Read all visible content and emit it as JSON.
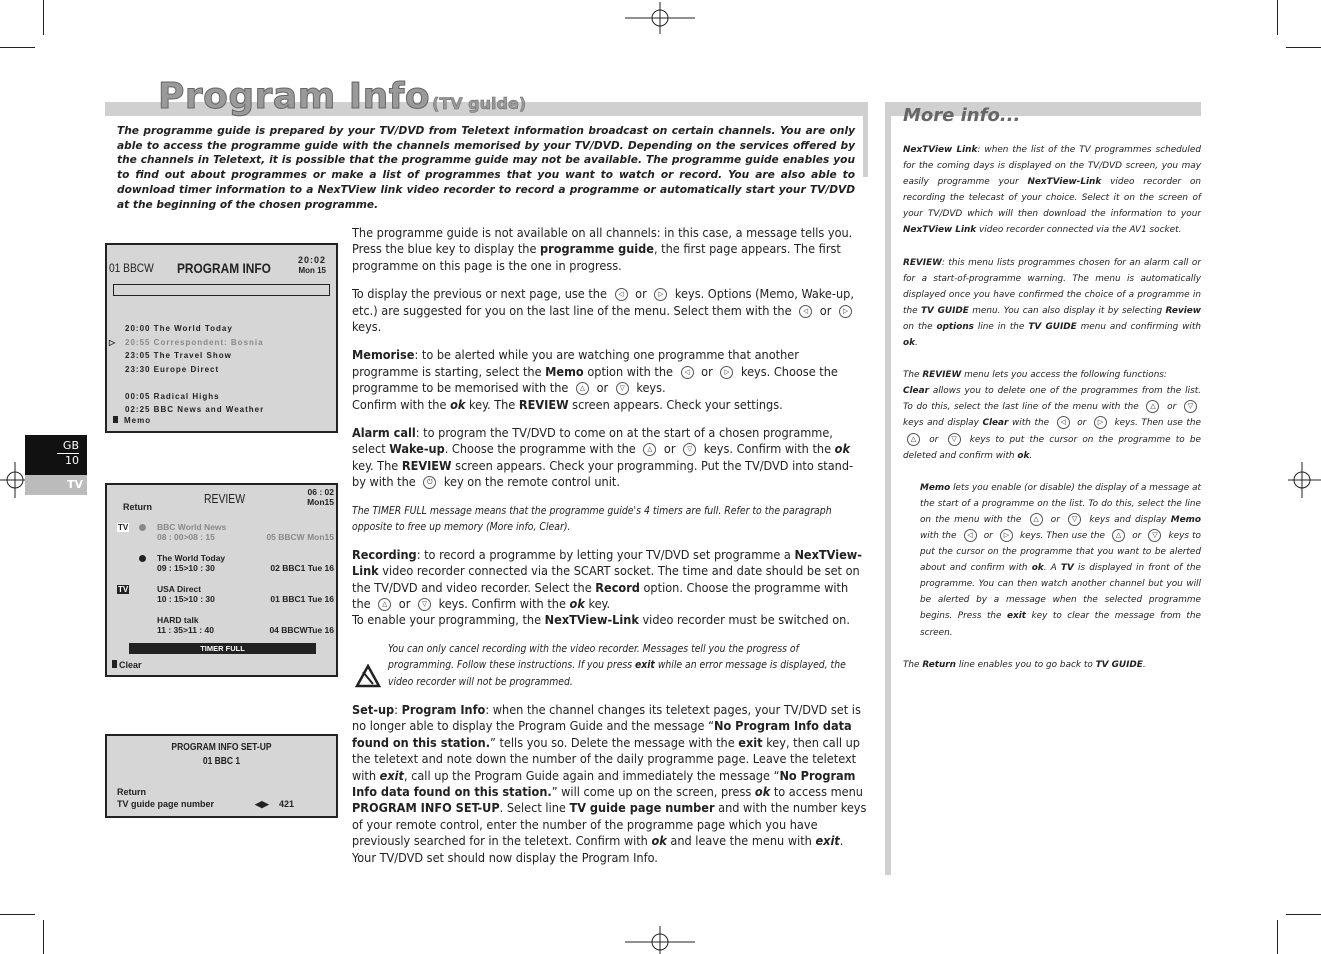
{
  "page": {
    "title": "Program Info",
    "subtitle": "(TV guide)",
    "intro": "The programme guide is prepared by your TV/DVD from Teletext information broadcast on certain channels. You are only able to access the programme guide with the channels memorised by your TV/DVD. Depending on the services offered by the channels in Teletext, it is possible that the programme guide may not be available. The programme guide enables you to find out about programmes or make a list of programmes that you want to watch or record. You are also able to download timer information to a NexTView link video recorder to record a programme or automatically start your TV/DVD at the beginning of the chosen programme."
  },
  "tab": {
    "lang": "GB",
    "page": "10",
    "section": "TV"
  },
  "screen1": {
    "channel": "01 BBCW",
    "title": "PROGRAM INFO",
    "time": "20:02",
    "date": "Mon 15",
    "items": [
      "20:00 The World Today",
      "20:55 Correspondent: Bosnia",
      "23:05 The Travel Show",
      "23:30 Europe Direct",
      "",
      "00:05 Radical Highs",
      "02:25 BBC News and Weather"
    ],
    "memo": "Memo"
  },
  "screen2": {
    "title": "REVIEW",
    "time": "06 : 02",
    "date": "Mon15",
    "return": "Return",
    "items": [
      {
        "icon": "TV",
        "clock": true,
        "name": "BBC World News",
        "time": "08 : 00>08 : 15",
        "ch": "05 BBCW Mon15",
        "dim": true
      },
      {
        "icon": "",
        "clock": true,
        "name": "The World Today",
        "time": "09 : 15>10 : 30",
        "ch": "02 BBC1  Tue 16"
      },
      {
        "icon": "TV",
        "clock": false,
        "name": "USA Direct",
        "time": "10 : 15>10 : 30",
        "ch": "01 BBC1  Tue 16"
      },
      {
        "icon": "",
        "clock": false,
        "name": "HARD talk",
        "time": "11 : 35>11 : 40",
        "ch": "04 BBCWTue 16"
      }
    ],
    "banner": "TIMER FULL",
    "clear": "Clear"
  },
  "screen3": {
    "title": "PROGRAM INFO SET-UP",
    "channel": "01 BBC 1",
    "return": "Return",
    "line": "TV guide page number",
    "value": "421"
  },
  "main": [
    [
      [
        "The programme guide is not available on all channels: in this case, a message tells you. Press the blue key to display the ",
        ""
      ],
      [
        "programme guide",
        "b"
      ],
      [
        ", the first page appears. The first programme on this page is the one in progress.",
        ""
      ]
    ],
    [
      [
        "To display the previous or next page, use the ",
        ""
      ],
      [
        "◁",
        "key"
      ],
      [
        " or ",
        ""
      ],
      [
        "▷",
        "key"
      ],
      [
        " keys. Options (Memo, Wake-up, etc.) are suggested for you on the last line of the menu. Select them with the ",
        ""
      ],
      [
        "◁",
        "key"
      ],
      [
        " or ",
        ""
      ],
      [
        "▷",
        "key"
      ],
      [
        " keys.",
        ""
      ]
    ],
    [
      [
        "Memorise",
        "b"
      ],
      [
        ": to be alerted while you are watching one programme that another programme is starting, select the ",
        ""
      ],
      [
        "Memo",
        "b"
      ],
      [
        " option with the ",
        ""
      ],
      [
        "◁",
        "key"
      ],
      [
        " or ",
        ""
      ],
      [
        "▷",
        "key"
      ],
      [
        " keys. Choose the programme to be memorised with the ",
        ""
      ],
      [
        "△",
        "key"
      ],
      [
        " or ",
        ""
      ],
      [
        "▽",
        "key"
      ],
      [
        " keys.\nConfirm with the ",
        ""
      ],
      [
        "ok",
        "bi"
      ],
      [
        " key. The ",
        ""
      ],
      [
        "REVIEW",
        "b"
      ],
      [
        " screen appears. Check your settings.",
        ""
      ]
    ],
    [
      [
        "Alarm call",
        "b"
      ],
      [
        ": to program the TV/DVD to come on at the start of a chosen programme, select ",
        ""
      ],
      [
        "Wake-up",
        "b"
      ],
      [
        ". Choose the programme with the ",
        ""
      ],
      [
        "△",
        "key"
      ],
      [
        " or ",
        ""
      ],
      [
        "▽",
        "key"
      ],
      [
        " keys. Confirm with the ",
        ""
      ],
      [
        "ok",
        "bi"
      ],
      [
        " key. The ",
        ""
      ],
      [
        "REVIEW",
        "b"
      ],
      [
        " screen appears. Check your programming. Put the TV/DVD into stand-by with the ",
        ""
      ],
      [
        "⏻",
        "key"
      ],
      [
        " key on the remote control unit.",
        ""
      ]
    ],
    [
      [
        "The TIMER FULL message means that the programme guide's 4 timers are full. Refer to the paragraph opposite to free up memory (More info, Clear).",
        "small"
      ]
    ],
    [
      [
        "Recording",
        "b"
      ],
      [
        ": to record a programme by letting your TV/DVD set programme a ",
        ""
      ],
      [
        "NexTView-Link",
        "b"
      ],
      [
        " video recorder connected via the SCART socket. The time and date should be set on the TV/DVD and video recorder. Select the ",
        ""
      ],
      [
        "Record",
        "b"
      ],
      [
        " option.  Choose the programme with the ",
        ""
      ],
      [
        "△",
        "key"
      ],
      [
        " or ",
        ""
      ],
      [
        "▽",
        "key"
      ],
      [
        " keys. Confirm with the ",
        ""
      ],
      [
        "ok",
        "bi"
      ],
      [
        " key.\nTo enable your programming, the ",
        ""
      ],
      [
        "NexTView-Link",
        "b"
      ],
      [
        " video recorder must be switched on.",
        ""
      ]
    ],
    [
      [
        "You can only cancel recording with the video recorder. Messages tell you the progress of programming. Follow these instructions. If you press ",
        "note"
      ],
      [
        "exit",
        "bi"
      ],
      [
        " while an error message is displayed, the video recorder will not be programmed.",
        ""
      ]
    ],
    [
      [
        "Set-up",
        "b"
      ],
      [
        ": ",
        ""
      ],
      [
        "Program Info",
        "b"
      ],
      [
        ": when the channel changes its teletext pages, your TV/DVD set is no longer able to display the Program Guide and the message “",
        ""
      ],
      [
        "No Program Info data found on this station.",
        "b"
      ],
      [
        "” tells you so. Delete the message with the ",
        ""
      ],
      [
        "exit",
        "b"
      ],
      [
        " key, then call up the teletext and note down the number of the daily programme page. Leave the teletext with ",
        ""
      ],
      [
        "exit",
        "bi"
      ],
      [
        ", call up the Program Guide again and immediately the message “",
        ""
      ],
      [
        "No Program Info data found on this station.",
        "b"
      ],
      [
        "” will come up on the screen, press ",
        ""
      ],
      [
        "ok",
        "bi"
      ],
      [
        " to access menu ",
        ""
      ],
      [
        "PROGRAM INFO SET-UP",
        "b"
      ],
      [
        ". Select line ",
        ""
      ],
      [
        "TV guide page number",
        "b"
      ],
      [
        " and with the number keys of your remote control, enter the number of the programme page which you have previously searched for in the teletext. Confirm with ",
        ""
      ],
      [
        "ok",
        "bi"
      ],
      [
        " and leave the menu with ",
        ""
      ],
      [
        "exit",
        "bi"
      ],
      [
        ". Your TV/DVD set should now display the Program Info.",
        ""
      ]
    ]
  ],
  "side": {
    "title": "More info...",
    "paras": [
      [
        [
          "NexTView Link",
          "b"
        ],
        [
          ": when the list of the TV programmes scheduled for the coming days is displayed on the TV/DVD screen, you may easily programme your ",
          ""
        ],
        [
          "NexTView-Link",
          "b"
        ],
        [
          " video recorder on recording the telecast of your choice. Select it on the screen of your TV/DVD which will then download the information to your ",
          ""
        ],
        [
          "NexTView Link",
          "b"
        ],
        [
          " video recorder connected via the AV1  socket.",
          ""
        ]
      ],
      [
        [
          "",
          ""
        ]
      ],
      [
        [
          "REVIEW",
          "b"
        ],
        [
          ": this menu lists programmes chosen for an alarm call or for a start-of-programme warning. The menu is automatically displayed once you have confirmed the choice of a programme in the ",
          ""
        ],
        [
          "TV GUIDE",
          "b"
        ],
        [
          " menu. You can also display it by selecting ",
          ""
        ],
        [
          "Review",
          "b"
        ],
        [
          " on the ",
          ""
        ],
        [
          "options",
          "b"
        ],
        [
          " line in the ",
          ""
        ],
        [
          "TV GUIDE",
          "b"
        ],
        [
          " menu and confirming with ",
          ""
        ],
        [
          "ok",
          "b"
        ],
        [
          ".",
          ""
        ]
      ],
      [
        [
          "The ",
          ""
        ],
        [
          "REVIEW",
          "b"
        ],
        [
          " menu lets you access the following functions:\n",
          ""
        ],
        [
          "Clear",
          "b"
        ],
        [
          " allows you to delete one of the programmes from the list. To do this, select the last line of the menu with the ",
          ""
        ],
        [
          "△",
          "key"
        ],
        [
          " or ",
          ""
        ],
        [
          "▽",
          "key"
        ],
        [
          " keys and display ",
          ""
        ],
        [
          "Clear",
          "b"
        ],
        [
          " with the ",
          ""
        ],
        [
          "◁",
          "key"
        ],
        [
          " or ",
          ""
        ],
        [
          "▷",
          "key"
        ],
        [
          " keys. Then use the ",
          ""
        ],
        [
          "△",
          "key"
        ],
        [
          " or ",
          ""
        ],
        [
          "▽",
          "key"
        ],
        [
          " keys to put the cursor on the programme to be deleted and confirm with ",
          ""
        ],
        [
          "ok",
          "b"
        ],
        [
          ".",
          ""
        ]
      ],
      [
        [
          "Memo",
          "b"
        ],
        [
          " lets you enable (or disable) the display of a message at the start of a programme on the list. To do this, select the line on the menu with the ",
          ""
        ],
        [
          "△",
          "key"
        ],
        [
          " or ",
          ""
        ],
        [
          "▽",
          "key"
        ],
        [
          " keys and display ",
          ""
        ],
        [
          "Memo",
          "b"
        ],
        [
          " with the ",
          ""
        ],
        [
          "◁",
          "key"
        ],
        [
          " or ",
          ""
        ],
        [
          "▷",
          "key"
        ],
        [
          " keys. Then use the ",
          ""
        ],
        [
          "△",
          "key"
        ],
        [
          " or ",
          ""
        ],
        [
          "▽",
          "key"
        ],
        [
          " keys to put the cursor on the programme that you want to be alerted about and confirm with ",
          ""
        ],
        [
          "ok",
          "b"
        ],
        [
          ". A ",
          ""
        ],
        [
          "TV",
          "b"
        ],
        [
          " is displayed in front of the programme. You can then watch another channel but you will be alerted by a message when the selected programme begins. Press the ",
          ""
        ],
        [
          "exit",
          "b"
        ],
        [
          " key to clear the message from the screen.",
          ""
        ]
      ],
      [
        [
          "The ",
          ""
        ],
        [
          "Return",
          "b"
        ],
        [
          " line enables you to go back to ",
          ""
        ],
        [
          "TV GUIDE",
          "b"
        ],
        [
          ".",
          ""
        ]
      ]
    ]
  }
}
